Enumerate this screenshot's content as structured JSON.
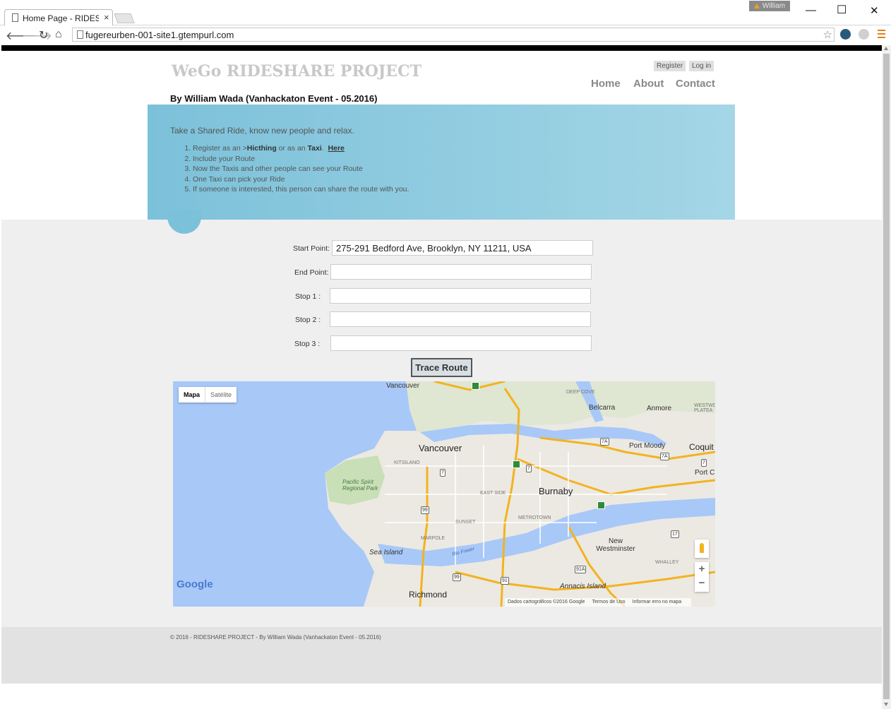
{
  "browser": {
    "tab_title": "Home Page - RIDESH",
    "tab_close": "×",
    "user_badge": "William",
    "url": "fugereurben-001-site1.gtempurl.com",
    "window_minimize": "—",
    "window_maximize": "☐",
    "window_close": "✕"
  },
  "header": {
    "site_title": "WeGo RIDESHARE PROJECT",
    "byline": "By William Wada (Vanhackaton Event - 05.2016)",
    "register": "Register",
    "login": "Log in",
    "nav": [
      "Home",
      "About",
      "Contact"
    ]
  },
  "featured": {
    "intro": "Take a Shared Ride, know new people and relax.",
    "step1_pre": "Register as an >",
    "step1_hitch": "Hicthing",
    "step1_mid": " or as an ",
    "step1_taxi": "Taxi",
    "step1_link": "Here",
    "step2": "Include your Route",
    "step3": "Now the Taxis and other people can see your Route",
    "step4": "One Taxi can pick your Ride",
    "step5": "If someone is interested, this person can share the route with you."
  },
  "form": {
    "start_label": "Start Point:",
    "start_value": "275-291 Bedford Ave, Brooklyn, NY 11211, USA",
    "end_label": "End Point:",
    "end_value": "",
    "stop1_label": "Stop 1 :",
    "stop2_label": "Stop 2 :",
    "stop3_label": "Stop 3 :",
    "trace_button": "Trace Route"
  },
  "map": {
    "type_map": "Mapa",
    "type_satellite": "Satélite",
    "labels": {
      "vancouver_top": "Vancouver",
      "deep_cove": "DEEP COVE",
      "belcarra": "Belcarra",
      "anmore": "Anmore",
      "westwood": "WESTWO PLATEA",
      "port_moody": "Port Moody",
      "coquitlam": "Coquit",
      "port_c": "Port C",
      "vancouver": "Vancouver",
      "kitsilano": "KITSILANO",
      "pacific_spirit": "Pacific Spirit Regional Park",
      "east_side": "EAST SIDE",
      "burnaby": "Burnaby",
      "metrotown": "METROTOWN",
      "sunset": "SUNSET",
      "marpole": "MARPOLE",
      "sea_island": "Sea Island",
      "rio_fraser": "Rio Fraser",
      "new_westminster": "New Westminster",
      "whalley": "WHALLEY",
      "richmond": "Richmond",
      "annacis": "Annacis Island"
    },
    "highways": [
      "7A",
      "7A",
      "7",
      "7",
      "7",
      "99",
      "17",
      "91A",
      "99",
      "91"
    ],
    "zoom_in": "+",
    "zoom_out": "−",
    "google": "Google",
    "footer_data": "Dados cartográficos ©2016 Google",
    "footer_terms": "Termos de Uso",
    "footer_report": "Informar erro no mapa"
  },
  "footer": {
    "copyright": "© 2016 - RIDESHARE PROJECT - By William Wada (Vanhackaton Event - 05.2016)"
  },
  "colors": {
    "featured_left": "#7cc1da",
    "featured_right": "#a4d6e6",
    "water": "#a8c8f8",
    "land": "#ece9e2",
    "road": "#f2b320"
  }
}
